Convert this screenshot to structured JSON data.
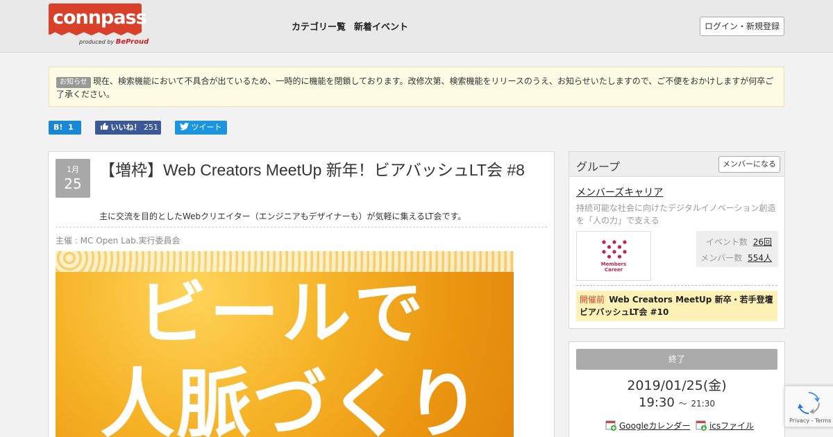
{
  "header": {
    "logo_text": "connpass",
    "logo_sub_prefix": "produced by",
    "logo_sub_brand": "BeProud",
    "nav": [
      "カテゴリー覧",
      "新着イベント"
    ],
    "login_label": "ログイン・新規登録"
  },
  "notice": {
    "badge": "お知らせ",
    "text": "現在、検索機能において不具合が出ているため、一時的に機能を閉鎖しております。改修次第、検索機能をリリースのうえ、お知らせいたしますので、ご不便をおかけしますが何卒ご了承ください。"
  },
  "social": {
    "hatena_label": "B!",
    "hatena_count": "1",
    "like_label": "いいね！",
    "like_count": "251",
    "tweet_label": "ツイート"
  },
  "event": {
    "month": "1月",
    "day": "25",
    "title": "【増枠】Web Creators MeetUp 新年！ビアバッシュLT会 #8",
    "description": "主に交流を目的としたWebクリエイター（エンジニアもデザイナーも）が気軽に集えるLT会です。",
    "organizer": "主催 : MC Open Lab.実行委員会",
    "banner_line1": "ビールで",
    "banner_line2": "人脈づくり"
  },
  "group": {
    "heading": "グループ",
    "join_label": "メンバーになる",
    "name": "メンバーズキャリア",
    "description": "持続可能な社会に向けたデジタルイノベーション創造を「人の力」で支える",
    "logo_caption_1": "Members",
    "logo_caption_2": "Career",
    "events_label": "イベント数",
    "events_value": "26回",
    "members_label": "メンバー数",
    "members_value": "554人",
    "upcoming_tag": "開催前",
    "upcoming_title": "Web Creators MeetUp 新卒・若手登壇ビアバッシュLT会 #10"
  },
  "when": {
    "status": "終了",
    "date": "2019/01/25(金)",
    "start": "19:30",
    "separator": "～",
    "end": "21:30",
    "google_label": "Googleカレンダー",
    "ics_label": "icsファイル"
  },
  "recaptcha": {
    "footer": "Privacy - Terms"
  },
  "colors": {
    "brand": "#d8402a",
    "hatena": "#1a86d6",
    "facebook": "#3b5998",
    "twitter": "#1b95e0",
    "upcoming_bg": "#fdf1b6"
  }
}
